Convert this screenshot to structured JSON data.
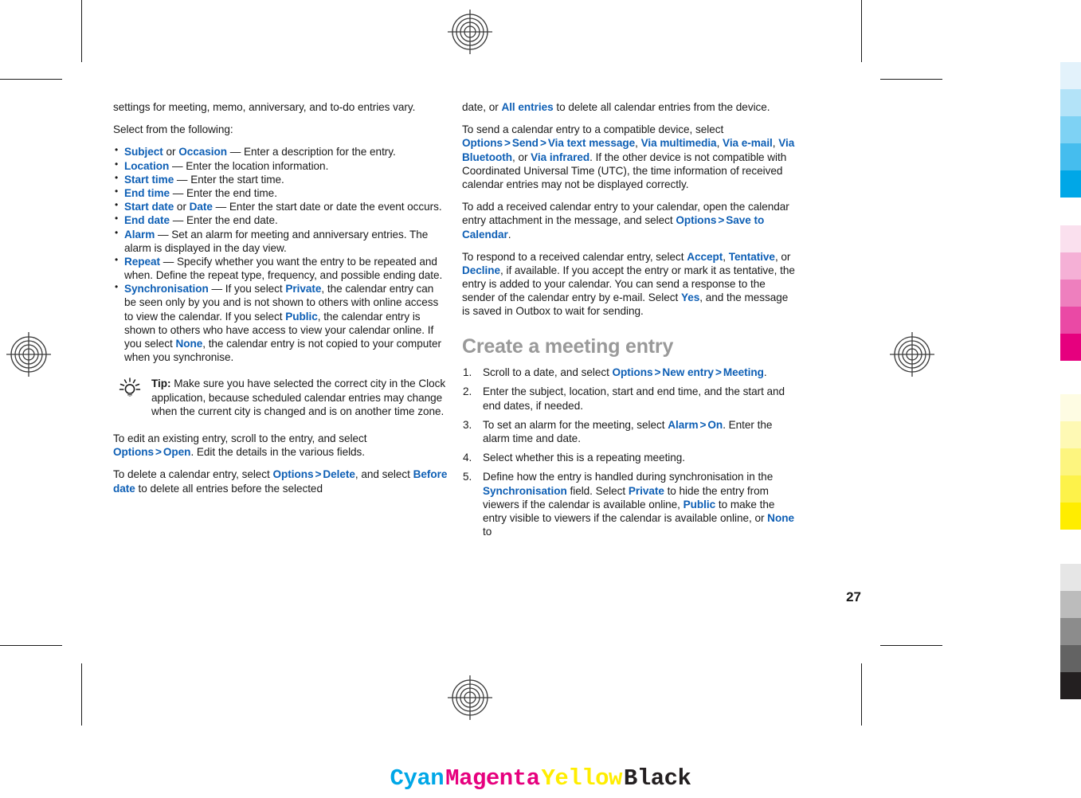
{
  "document": {
    "page_number": "27",
    "section_heading": "Create a meeting entry"
  },
  "colors": {
    "ui_term_blue": "#0e5fb5",
    "heading_gray": "#999999",
    "body_black": "#1a1a1a",
    "cyan": "#00a7e7",
    "magenta": "#e6007e",
    "yellow": "#ffed00",
    "black": "#231f20"
  },
  "icons": {
    "tip": "lightbulb-icon",
    "registration": "registration-target-icon"
  },
  "left_column": {
    "intro": {
      "line1": "settings for meeting, memo, anniversary, and to-do entries vary.",
      "line2": "Select from the following:"
    },
    "bullets": [
      {
        "terms": [
          "Subject",
          "Occasion"
        ],
        "joiner": " or ",
        "text": " — Enter a description for the entry."
      },
      {
        "terms": [
          "Location"
        ],
        "joiner": "",
        "text": " — Enter the location information."
      },
      {
        "terms": [
          "Start time"
        ],
        "joiner": "",
        "text": " — Enter the start time."
      },
      {
        "terms": [
          "End time"
        ],
        "joiner": "",
        "text": " — Enter the end time."
      },
      {
        "terms": [
          "Start date",
          "Date"
        ],
        "joiner": " or ",
        "text": " — Enter the start date or date the event occurs."
      },
      {
        "terms": [
          "End date"
        ],
        "joiner": "",
        "text": " — Enter the end date."
      },
      {
        "terms": [
          "Alarm"
        ],
        "joiner": "",
        "text": " — Set an alarm for meeting and anniversary entries. The alarm is displayed in the day view."
      },
      {
        "terms": [
          "Repeat"
        ],
        "joiner": "",
        "text": " — Specify whether you want the entry to be repeated and when. Define the repeat type, frequency, and possible ending date."
      }
    ],
    "sync_bullet": {
      "term": "Synchronisation",
      "part1": " — If you select ",
      "private": "Private",
      "part2": ", the calendar entry can be seen only by you and is not shown to others with online access to view the calendar. If you select ",
      "public": "Public",
      "part3": ", the calendar entry is shown to others who have access to view your calendar online. If you select ",
      "none": "None",
      "part4": ", the calendar entry is not copied to your computer when you synchronise."
    },
    "tip": {
      "label": "Tip:",
      "text": " Make sure you have selected the correct city in the Clock application, because scheduled calendar entries may change when the current city is changed and is on another time zone."
    },
    "edit_paragraph": {
      "part1": "To edit an existing entry, scroll to the entry, and select ",
      "options": "Options",
      "gt": ">",
      "open": "Open",
      "part2": ". Edit the details in the various fields."
    },
    "delete_paragraph": {
      "part1": "To delete a calendar entry, select ",
      "options": "Options",
      "gt": ">",
      "delete": "Delete",
      "part2": ", and select ",
      "before_date": "Before date",
      "part3": " to delete all entries before the selected"
    }
  },
  "right_column": {
    "delete_continued": {
      "part1": "date, or ",
      "all_entries": "All entries",
      "part2": " to delete all calendar entries from the device."
    },
    "send_paragraph": {
      "part1": "To send a calendar entry to a compatible device, select ",
      "options": "Options",
      "gt1": ">",
      "send": "Send",
      "gt2": ">",
      "via_text": "Via text message",
      "sep1": ", ",
      "via_multimedia": "Via multimedia",
      "sep2": ", ",
      "via_email": "Via e-mail",
      "sep3": ", ",
      "via_bluetooth": "Via Bluetooth",
      "sep4": ", or ",
      "via_infrared": "Via infrared",
      "part2": ". If the other device is not compatible with Coordinated Universal Time (UTC), the time information of received calendar entries may not be displayed correctly."
    },
    "add_paragraph": {
      "part1": "To add a received calendar entry to your calendar, open the calendar entry attachment in the message, and select ",
      "options": "Options",
      "gt": ">",
      "save_to_calendar": "Save to Calendar",
      "part2": "."
    },
    "respond_paragraph": {
      "part1": "To respond to a received calendar entry, select ",
      "accept": "Accept",
      "sep1": ", ",
      "tentative": "Tentative",
      "sep2": ", or ",
      "decline": "Decline",
      "part2": ", if available. If you accept the entry or mark it as tentative, the entry is added to your calendar. You can send a response to the sender of the calendar entry by e-mail. Select ",
      "yes": "Yes",
      "part3": ", and the message is saved in Outbox to wait for sending."
    },
    "steps": {
      "step1": {
        "part1": "Scroll to a date, and select ",
        "options": "Options",
        "gt1": ">",
        "new_entry": "New entry",
        "gt2": ">",
        "meeting": "Meeting",
        "part2": "."
      },
      "step2": {
        "text": "Enter the subject, location, start and end time, and the start and end dates, if needed."
      },
      "step3": {
        "part1": "To set an alarm for the meeting, select ",
        "alarm": "Alarm",
        "gt": ">",
        "on": "On",
        "part2": ". Enter the alarm time and date."
      },
      "step4": {
        "text": "Select whether this is a repeating meeting."
      },
      "step5": {
        "part1": "Define how the entry is handled during synchronisation in the ",
        "synchronisation": "Synchronisation",
        "part2": " field. Select ",
        "private": "Private",
        "part3": " to hide the entry from viewers if the calendar is available online, ",
        "public": "Public",
        "part4": " to make the entry visible to viewers if the calendar is available online, or ",
        "none": "None",
        "part5": " to"
      }
    }
  },
  "color_bars": {
    "cyan_steps": [
      "#e3f2fb",
      "#b3e3f8",
      "#7ed2f4",
      "#45bdee",
      "#00a7e7"
    ],
    "magenta_steps": [
      "#fae0ee",
      "#f5b0d6",
      "#ee7fbe",
      "#ea49a5",
      "#e6007e"
    ],
    "yellow_steps": [
      "#fefce3",
      "#fef9b4",
      "#fdf57f",
      "#fdf24a",
      "#ffed00"
    ],
    "black_steps": [
      "#e6e6e6",
      "#bcbcbc",
      "#8c8c8c",
      "#636363",
      "#231f20"
    ]
  },
  "footer": {
    "cyan_label": "Cyan",
    "magenta_label": "Magenta",
    "yellow_label": "Yellow",
    "black_label": "Black"
  }
}
